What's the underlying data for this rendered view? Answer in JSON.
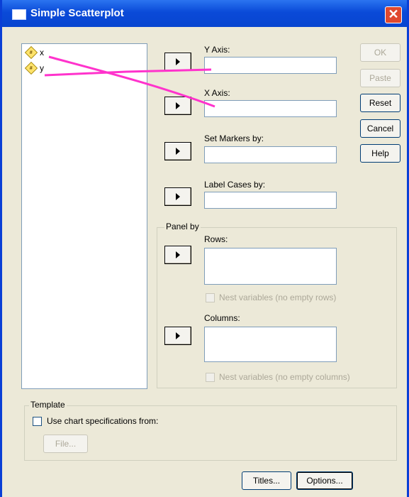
{
  "window": {
    "title": "Simple Scatterplot",
    "close_glyph": "✕"
  },
  "variables": [
    {
      "icon": "#",
      "name": "x"
    },
    {
      "icon": "#",
      "name": "y"
    }
  ],
  "fields": {
    "y_axis": {
      "label": "Y Axis:",
      "value": ""
    },
    "x_axis": {
      "label": "X Axis:",
      "value": ""
    },
    "set_markers": {
      "label": "Set Markers by:",
      "value": ""
    },
    "label_cases": {
      "label": "Label Cases by:",
      "value": ""
    }
  },
  "side_buttons": {
    "ok": "OK",
    "paste": "Paste",
    "reset": "Reset",
    "cancel": "Cancel",
    "help": "Help"
  },
  "panel_by": {
    "title": "Panel by",
    "rows_label": "Rows:",
    "rows_nest": "Nest variables (no empty rows)",
    "columns_label": "Columns:",
    "columns_nest": "Nest variables (no empty columns)"
  },
  "template": {
    "title": "Template",
    "use_chart_spec": "Use chart specifications from:",
    "file_button": "File..."
  },
  "bottom_buttons": {
    "titles": "Titles...",
    "options": "Options..."
  },
  "colors": {
    "titlebar": "#0a4ad8",
    "annotation": "#ff33cc",
    "dialog_bg": "#ece9d8"
  }
}
